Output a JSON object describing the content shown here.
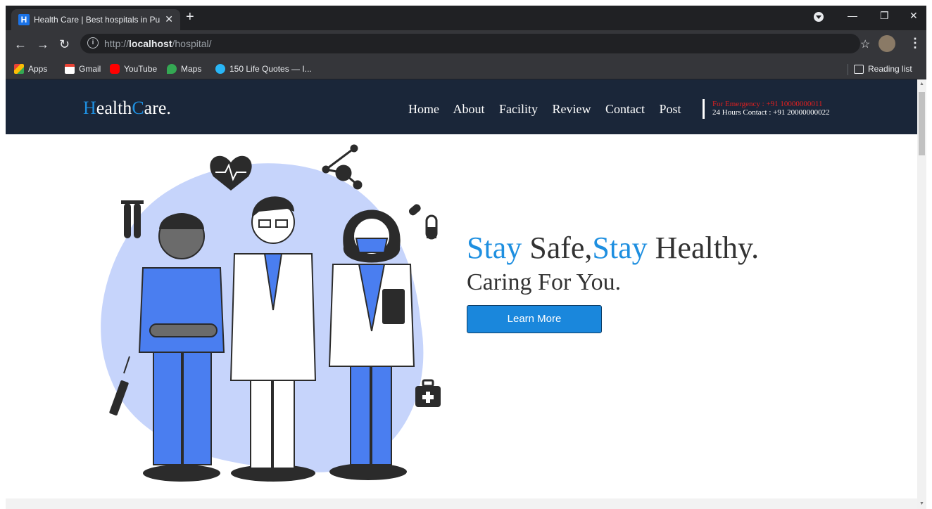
{
  "browser": {
    "tab_title": "Health Care | Best hospitals in Pu",
    "tab_favicon": "H",
    "url_scheme": "http://",
    "url_host": "localhost",
    "url_path": "/hospital/",
    "bookmarks": [
      {
        "label": "Apps",
        "icon": "apps-grid-icon",
        "color": "#ea4335"
      },
      {
        "label": "Gmail",
        "icon": "gmail-icon",
        "color": "#ea4335"
      },
      {
        "label": "YouTube",
        "icon": "youtube-icon",
        "color": "#ff0000"
      },
      {
        "label": "Maps",
        "icon": "maps-icon",
        "color": "#34a853"
      },
      {
        "label": "150 Life Quotes — I...",
        "icon": "pinterest-icon",
        "color": "#29b6f6"
      }
    ],
    "reading_list": "Reading list"
  },
  "site": {
    "logo_first_initial": "H",
    "logo_first_rest": "ealth",
    "logo_second_initial": "C",
    "logo_second_rest": "are.",
    "nav": [
      "Home",
      "About",
      "Facility",
      "Review",
      "Contact",
      "Post"
    ],
    "emergency_text": "For Emergency : +91 10000000011",
    "hours_text": "24 Hours Contact : +91 20000000022",
    "hero": {
      "stay1": "Stay",
      "safe": " Safe,",
      "stay2": "Stay",
      "healthy": " Healthy.",
      "subline": "Caring For You.",
      "cta_label": "Learn More"
    },
    "colors": {
      "navbar_bg": "#1a2639",
      "accent_blue": "#1e8fe0",
      "emergency_red": "#e02020",
      "cta_bg": "#1a87dc"
    }
  }
}
